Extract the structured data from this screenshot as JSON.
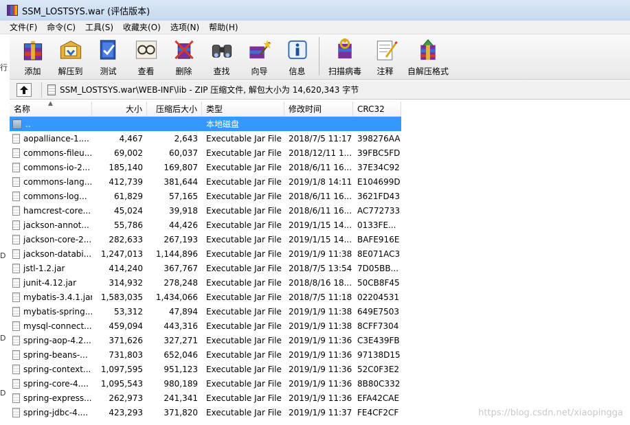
{
  "window": {
    "title": "SSM_LOSTSYS.war (评估版本)"
  },
  "menu": [
    "文件(F)",
    "命令(C)",
    "工具(S)",
    "收藏夹(O)",
    "选项(N)",
    "帮助(H)"
  ],
  "toolbar": [
    {
      "label": "添加",
      "icon": "add-icon"
    },
    {
      "label": "解压到",
      "icon": "extract-icon"
    },
    {
      "label": "测试",
      "icon": "test-icon"
    },
    {
      "label": "查看",
      "icon": "view-icon"
    },
    {
      "label": "删除",
      "icon": "delete-icon"
    },
    {
      "label": "查找",
      "icon": "find-icon"
    },
    {
      "label": "向导",
      "icon": "wizard-icon"
    },
    {
      "label": "信息",
      "icon": "info-icon"
    },
    {
      "label": "扫描病毒",
      "icon": "virus-scan-icon"
    },
    {
      "label": "注释",
      "icon": "comment-icon"
    },
    {
      "label": "自解压格式",
      "icon": "sfx-icon"
    }
  ],
  "address": {
    "path": "SSM_LOSTSYS.war\\WEB-INF\\lib - ZIP 压缩文件, 解包大小为 14,620,343 字节"
  },
  "columns": {
    "name": "名称",
    "size": "大小",
    "packed": "压缩后大小",
    "type": "类型",
    "modified": "修改时间",
    "crc": "CRC32"
  },
  "parent_row": {
    "name": "..",
    "type": "本地磁盘"
  },
  "files": [
    {
      "name": "aopalliance-1....",
      "size": "4,467",
      "packed": "2,643",
      "type": "Executable Jar File",
      "modified": "2018/7/5 11:17",
      "crc": "398276AA"
    },
    {
      "name": "commons-fileu...",
      "size": "69,002",
      "packed": "60,037",
      "type": "Executable Jar File",
      "modified": "2018/12/11 1...",
      "crc": "39FBC5FD"
    },
    {
      "name": "commons-io-2...",
      "size": "185,140",
      "packed": "169,807",
      "type": "Executable Jar File",
      "modified": "2018/6/11 16...",
      "crc": "37E34C92"
    },
    {
      "name": "commons-lang...",
      "size": "412,739",
      "packed": "381,644",
      "type": "Executable Jar File",
      "modified": "2019/1/8 14:11",
      "crc": "E104699D"
    },
    {
      "name": "commons-log...",
      "size": "61,829",
      "packed": "57,165",
      "type": "Executable Jar File",
      "modified": "2018/6/11 16...",
      "crc": "3621FD43"
    },
    {
      "name": "hamcrest-core...",
      "size": "45,024",
      "packed": "39,918",
      "type": "Executable Jar File",
      "modified": "2018/6/11 16...",
      "crc": "AC772733"
    },
    {
      "name": "jackson-annot...",
      "size": "55,786",
      "packed": "44,426",
      "type": "Executable Jar File",
      "modified": "2019/1/15 14...",
      "crc": "0133FE..."
    },
    {
      "name": "jackson-core-2...",
      "size": "282,633",
      "packed": "267,193",
      "type": "Executable Jar File",
      "modified": "2019/1/15 14...",
      "crc": "BAFE916E"
    },
    {
      "name": "jackson-databi...",
      "size": "1,247,013",
      "packed": "1,144,896",
      "type": "Executable Jar File",
      "modified": "2019/1/9 11:38",
      "crc": "8E071AC3"
    },
    {
      "name": "jstl-1.2.jar",
      "size": "414,240",
      "packed": "367,767",
      "type": "Executable Jar File",
      "modified": "2018/7/5 13:54",
      "crc": "7D05BB..."
    },
    {
      "name": "junit-4.12.jar",
      "size": "314,932",
      "packed": "278,248",
      "type": "Executable Jar File",
      "modified": "2018/8/16 18...",
      "crc": "50CB8F45"
    },
    {
      "name": "mybatis-3.4.1.jar",
      "size": "1,583,035",
      "packed": "1,434,066",
      "type": "Executable Jar File",
      "modified": "2018/7/5 11:18",
      "crc": "02204531"
    },
    {
      "name": "mybatis-spring...",
      "size": "53,312",
      "packed": "47,894",
      "type": "Executable Jar File",
      "modified": "2019/1/9 11:38",
      "crc": "649E7503"
    },
    {
      "name": "mysql-connect...",
      "size": "459,094",
      "packed": "443,316",
      "type": "Executable Jar File",
      "modified": "2019/1/9 11:38",
      "crc": "8CFF7304"
    },
    {
      "name": "spring-aop-4.2...",
      "size": "371,626",
      "packed": "327,271",
      "type": "Executable Jar File",
      "modified": "2019/1/9 11:36",
      "crc": "C3E439FB"
    },
    {
      "name": "spring-beans-...",
      "size": "731,803",
      "packed": "652,046",
      "type": "Executable Jar File",
      "modified": "2019/1/9 11:36",
      "crc": "97138D15"
    },
    {
      "name": "spring-context...",
      "size": "1,097,595",
      "packed": "951,123",
      "type": "Executable Jar File",
      "modified": "2019/1/9 11:36",
      "crc": "52C0F3E2"
    },
    {
      "name": "spring-core-4....",
      "size": "1,095,543",
      "packed": "980,189",
      "type": "Executable Jar File",
      "modified": "2019/1/9 11:36",
      "crc": "8B80C332"
    },
    {
      "name": "spring-express...",
      "size": "262,973",
      "packed": "241,341",
      "type": "Executable Jar File",
      "modified": "2019/1/9 11:36",
      "crc": "EFA42CAE"
    },
    {
      "name": "spring-jdbc-4....",
      "size": "423,293",
      "packed": "371,820",
      "type": "Executable Jar File",
      "modified": "2019/1/9 11:37",
      "crc": "FE4CF2CF"
    }
  ],
  "watermark": "https://blog.csdn.net/xiaopingga",
  "left_strip": [
    "行",
    "D",
    "D",
    "D"
  ],
  "colors": {
    "selection": "#3399ff",
    "titlebar": "#c6d9ef"
  }
}
